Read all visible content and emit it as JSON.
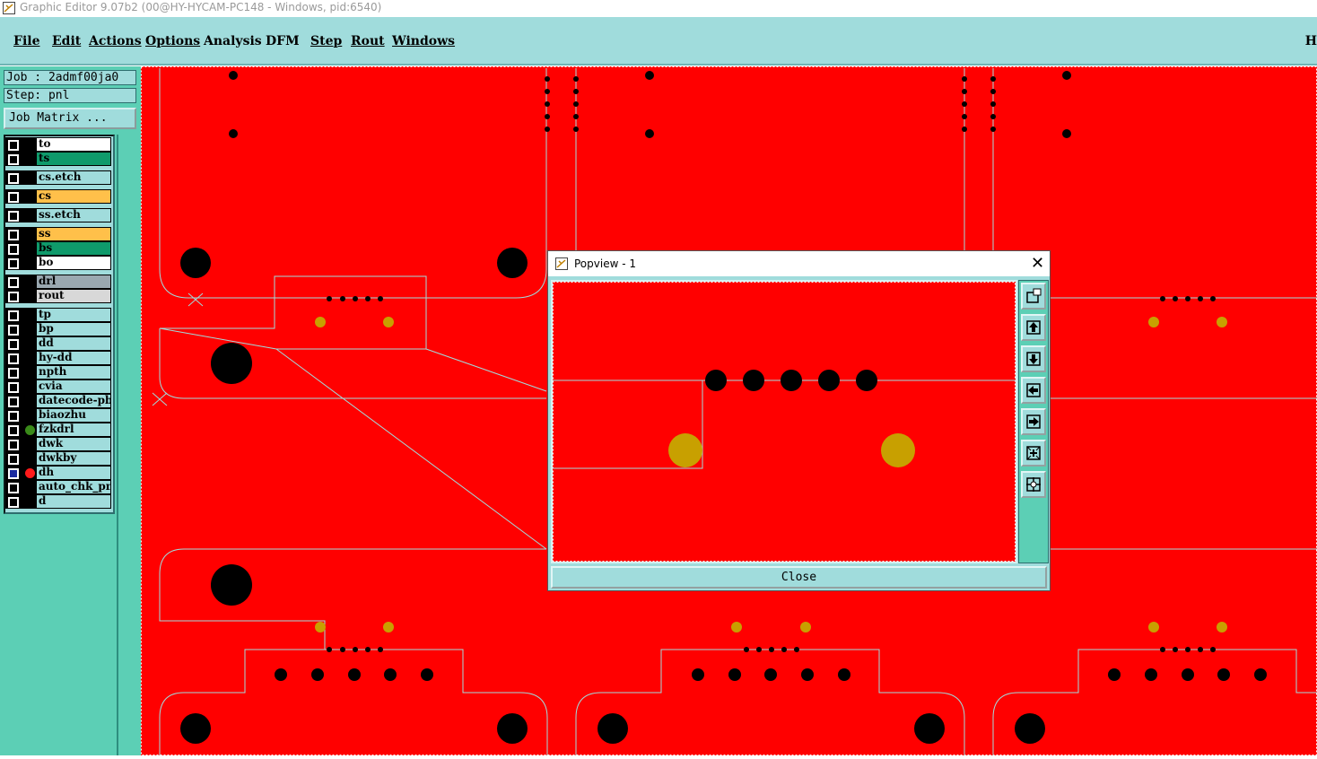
{
  "window": {
    "title": "Graphic Editor 9.07b2 (00@HY-HYCAM-PC148 - Windows, pid:6540)"
  },
  "menu": {
    "items": [
      {
        "label": "File"
      },
      {
        "label": "Edit"
      },
      {
        "label": "Actions"
      },
      {
        "label": "Options"
      },
      {
        "label": "Analysis"
      },
      {
        "label": "DFM"
      },
      {
        "label": "Step"
      },
      {
        "label": "Rout"
      },
      {
        "label": "Windows"
      }
    ],
    "right_label": "H"
  },
  "job": {
    "label": "Job : 2admf00ja0",
    "step": "Step: pnl",
    "matrix_button": "Job Matrix ..."
  },
  "layers": [
    {
      "name": "to",
      "color": "#ffffff",
      "marker": ""
    },
    {
      "name": "ts",
      "color": "#0f9a6b",
      "marker": ""
    },
    {
      "name": "cs.etch",
      "color": "#a0dcdc",
      "marker": ""
    },
    {
      "name": "cs",
      "color": "#ffc04a",
      "marker": ""
    },
    {
      "name": "ss.etch",
      "color": "#a0dcdc",
      "marker": ""
    },
    {
      "name": "ss",
      "color": "#ffc04a",
      "marker": ""
    },
    {
      "name": "bs",
      "color": "#0f9a6b",
      "marker": ""
    },
    {
      "name": "bo",
      "color": "#ffffff",
      "marker": ""
    },
    {
      "name": "drl",
      "color": "#9aa8b0",
      "marker": ""
    },
    {
      "name": "rout",
      "color": "#d8d8d8",
      "marker": ""
    },
    {
      "name": "tp",
      "color": "#a0dcdc",
      "marker": ""
    },
    {
      "name": "bp",
      "color": "#a0dcdc",
      "marker": ""
    },
    {
      "name": "dd",
      "color": "#a0dcdc",
      "marker": ""
    },
    {
      "name": "hy-dd",
      "color": "#a0dcdc",
      "marker": ""
    },
    {
      "name": "npth",
      "color": "#a0dcdc",
      "marker": ""
    },
    {
      "name": "cvia",
      "color": "#a0dcdc",
      "marker": ""
    },
    {
      "name": "datecode-pbc",
      "color": "#a0dcdc",
      "marker": ""
    },
    {
      "name": "biaozhu",
      "color": "#a0dcdc",
      "marker": ""
    },
    {
      "name": "fzkdrl",
      "color": "#a0dcdc",
      "marker": "#3a8a1a"
    },
    {
      "name": "dwk",
      "color": "#a0dcdc",
      "marker": ""
    },
    {
      "name": "dwkby",
      "color": "#a0dcdc",
      "marker": ""
    },
    {
      "name": "dh",
      "color": "#a0dcdc",
      "marker": "#ff1a1a"
    },
    {
      "name": "auto_chk_pnl",
      "color": "#a0dcdc",
      "marker": ""
    },
    {
      "name": "d",
      "color": "#a0dcdc",
      "marker": ""
    }
  ],
  "popview": {
    "title": "Popview - 1",
    "close_label": "Close",
    "close_glyph": "✕"
  },
  "colors": {
    "board": "#ff0000",
    "pad": "#000000",
    "gold_pad": "#c8a000",
    "outline": "#a0dcdc"
  }
}
